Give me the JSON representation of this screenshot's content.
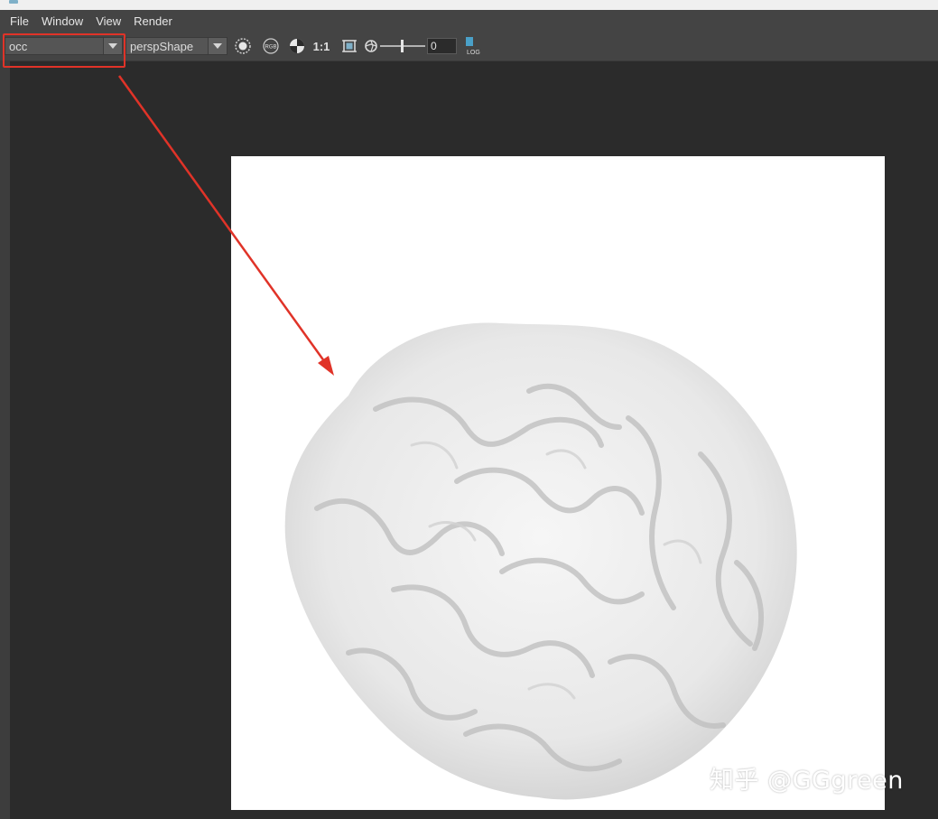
{
  "menubar": {
    "items": [
      {
        "label": "File"
      },
      {
        "label": "Window"
      },
      {
        "label": "View"
      },
      {
        "label": "Render"
      }
    ]
  },
  "toolbar": {
    "layer_dropdown": {
      "value": "occ"
    },
    "camera_dropdown": {
      "value": "perspShape"
    },
    "icons": [
      "snapshot-icon",
      "rgb-channel-icon",
      "alpha-checker-icon",
      "region-icon",
      "exposure-icon",
      "log-icon"
    ],
    "ratio_label": "1:1",
    "exposure_value": "0",
    "log_label": "LOG"
  },
  "viewport": {
    "render_subject": "brain ambient occlusion render",
    "render_background": "#ffffff"
  },
  "annotation": {
    "highlight_color": "#e03328"
  },
  "watermark": {
    "text": "知乎 @GGgreen"
  }
}
